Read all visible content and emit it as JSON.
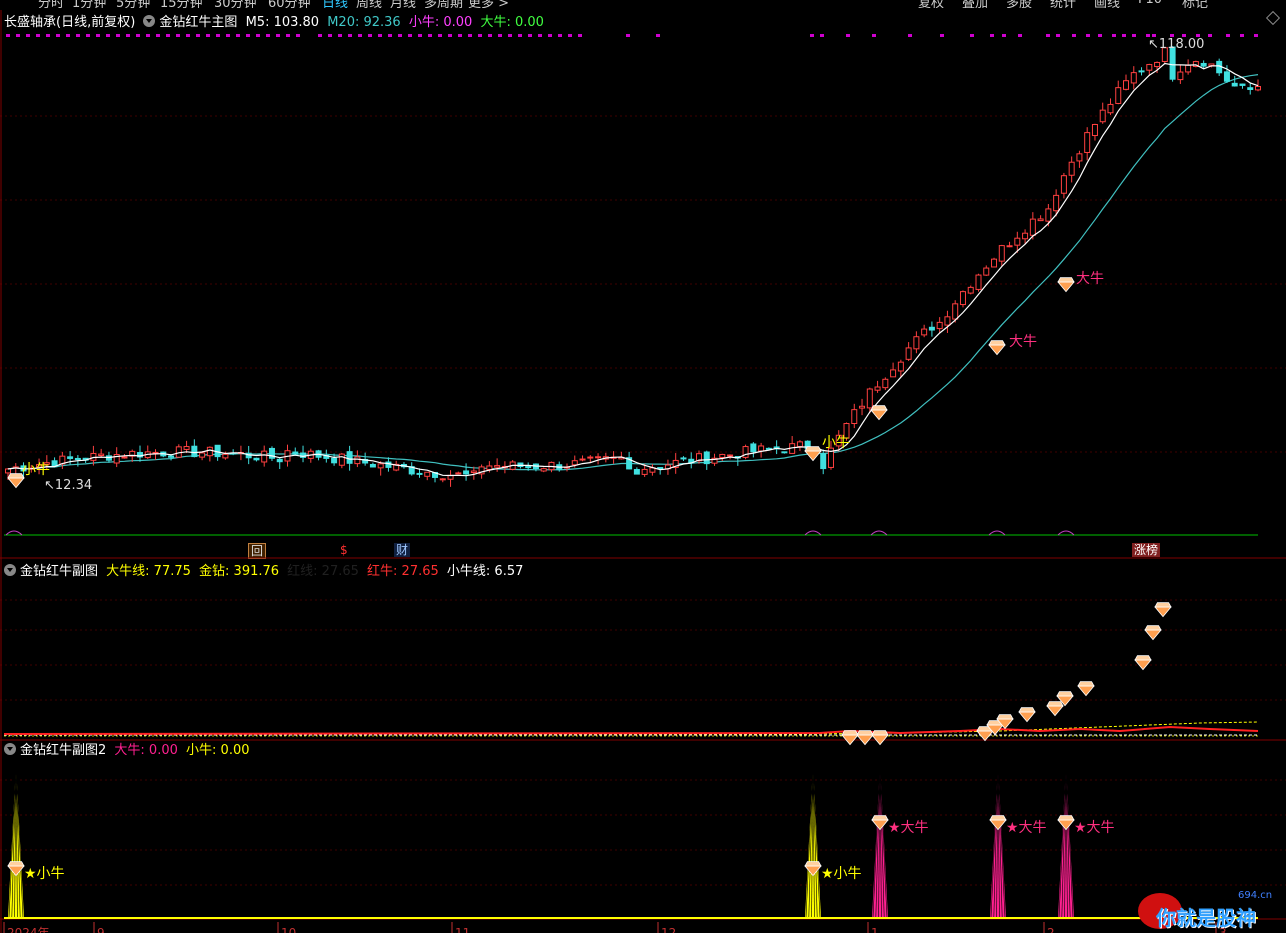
{
  "toolbar": {
    "period_tabs": [
      "分时",
      "1分钟",
      "5分钟",
      "15分钟",
      "30分钟",
      "60分钟",
      "日线",
      "周线",
      "月线",
      "多周期",
      "更多 >"
    ],
    "selected_period": "日线",
    "right_buttons": [
      "复权",
      "叠加",
      "多股",
      "统计",
      "画线",
      "F10",
      "标记"
    ]
  },
  "main_panel": {
    "stock_name": "长盛轴承(日线,前复权)",
    "indicator_name": "金钻红牛主图",
    "m5_label": "M5: 103.80",
    "m20_label": "M20: 92.36",
    "xiaoniu_label": "小牛: 0.00",
    "daniu_label": "大牛: 0.00",
    "high_price": "118.00",
    "low_price": "12.34",
    "signal_labels": {
      "xiaoniu": "小牛",
      "daniu": "大牛"
    },
    "event_tags": [
      {
        "text": "回",
        "color": "#ffcc88"
      },
      {
        "text": "$",
        "color": "#ff3030"
      },
      {
        "text": "财",
        "color": "#a0c8ff"
      },
      {
        "text": "涨榜",
        "color": "#ffffff"
      }
    ]
  },
  "sub_panel_1": {
    "indicator_name": "金钻红牛副图",
    "daniu_line": "大牛线: 77.75",
    "jinzuan": "金钻: 391.76",
    "hidden_label": "红线: 27.65",
    "hongniu": "红牛: 27.65",
    "xiaoniu_line": "小牛线: 6.57"
  },
  "sub_panel_2": {
    "indicator_name": "金钻红牛副图2",
    "daniu": "大牛: 0.00",
    "xiaoniu": "小牛: 0.00",
    "signal_xiaoniu": "★小牛",
    "signal_daniu": "★大牛"
  },
  "date_axis": {
    "labels": [
      "2024年",
      "9",
      "10",
      "11",
      "12",
      "1",
      "2",
      "3"
    ]
  },
  "watermark": {
    "text": "你就是股神",
    "site": "694.cn"
  },
  "colors": {
    "up": "#ff4040",
    "down": "#40e0e0",
    "m5": "#ffffff",
    "m20": "#40c0c0",
    "magenta": "#ff2090",
    "yellow": "#ffff00",
    "grid": "#400000"
  }
}
